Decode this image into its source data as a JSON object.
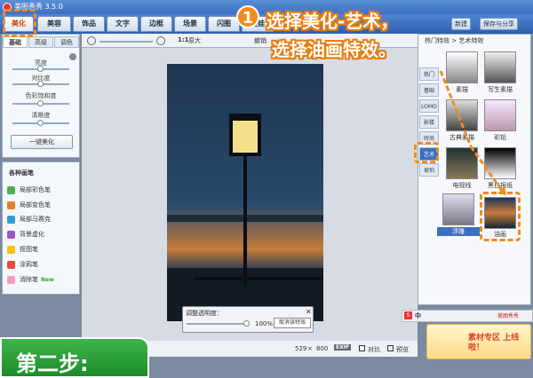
{
  "window": {
    "title": "美图秀秀 3.5.0"
  },
  "main_tabs": [
    "美化",
    "美容",
    "饰品",
    "文字",
    "边框",
    "场景",
    "闪图",
    "娃娃"
  ],
  "top_right": {
    "new_label": "新建",
    "save_label": "保存与分享"
  },
  "left_panel": {
    "subtabs": [
      "基础",
      "高级",
      "调色"
    ],
    "sliders": [
      "亮度",
      "对比度",
      "色彩饱和度",
      "清晰度"
    ],
    "one_click_label": "一键美化",
    "brush_title": "各种画笔",
    "brushes": [
      "局部彩色笔",
      "局部变色笔",
      "局部马赛克",
      "背景虚化",
      "抠图笔",
      "涂鸦笔",
      "消除笔"
    ],
    "new_badge": "New"
  },
  "toolbar": {
    "zoom_label": "1:1",
    "original_label": "原大",
    "undo_label": "撤销"
  },
  "opacity_box": {
    "title": "调整透明度：",
    "value": "100%",
    "cancel_label": "取消该特效"
  },
  "status": {
    "width": "529",
    "height": "800",
    "exif": "EXIF",
    "compare": "对比",
    "preview": "预览"
  },
  "right_panel": {
    "header": "热门特效 > 艺术特效",
    "category_tabs": [
      "热门",
      "基础",
      "LOMO",
      "影楼",
      "时尚",
      "艺术",
      "琥珀"
    ],
    "effects": [
      {
        "label": "素描"
      },
      {
        "label": "写生素描"
      },
      {
        "label": "古典素描"
      },
      {
        "label": "彩铅"
      },
      {
        "label": "电视线"
      },
      {
        "label": "黑白报纸"
      },
      {
        "label": "浮雕"
      },
      {
        "label": "油画"
      }
    ]
  },
  "ime_bar": {
    "lang": "中",
    "brand": "美图秀秀"
  },
  "promo": {
    "text": "素材专区 上线啦！"
  },
  "overlay": {
    "step_number": "1",
    "line1": "选择美化-艺术，",
    "line2": "选择油画特效。",
    "banner": "第二步:"
  },
  "colors": {
    "accent": "#f28c1e",
    "banner": "#2aa33a",
    "titlebar": "#3d6fc0"
  }
}
